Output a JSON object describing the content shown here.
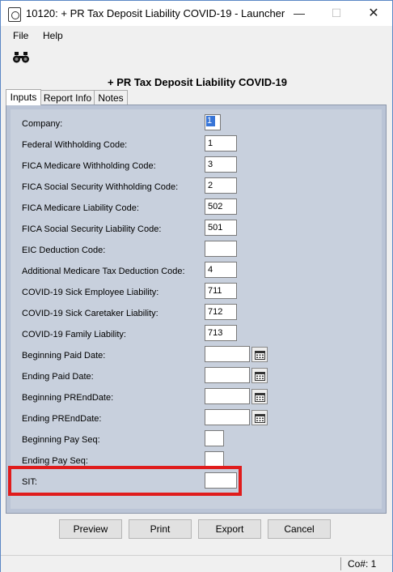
{
  "window": {
    "title": "10120: + PR Tax Deposit Liability COVID-19 - Launcher",
    "minimize_glyph": "—",
    "maximize_glyph": "☐",
    "close_glyph": "✕"
  },
  "menu": {
    "items": [
      "File",
      "Help"
    ]
  },
  "toolbar": {
    "icon": "binoculars-icon"
  },
  "heading": "+ PR Tax Deposit Liability COVID-19",
  "tabs": [
    "Inputs",
    "Report Info",
    "Notes"
  ],
  "form": {
    "fields": [
      {
        "label": "Company:",
        "value": "1"
      },
      {
        "label": "Federal Withholding Code:",
        "value": "1"
      },
      {
        "label": "FICA Medicare Withholding Code:",
        "value": "3"
      },
      {
        "label": "FICA Social Security Withholding Code:",
        "value": "2"
      },
      {
        "label": "FICA Medicare Liability Code:",
        "value": "502"
      },
      {
        "label": "FICA Social Security Liability Code:",
        "value": "501"
      },
      {
        "label": "EIC Deduction Code:",
        "value": ""
      },
      {
        "label": "Additional Medicare Tax Deduction Code:",
        "value": "4"
      },
      {
        "label": "COVID-19 Sick Employee Liability:",
        "value": "711"
      },
      {
        "label": "COVID-19 Sick Caretaker Liability:",
        "value": "712"
      },
      {
        "label": "COVID-19 Family Liability:",
        "value": "713"
      },
      {
        "label": "Beginning Paid Date:",
        "value": ""
      },
      {
        "label": "Ending Paid Date:",
        "value": ""
      },
      {
        "label": "Beginning PREndDate:",
        "value": ""
      },
      {
        "label": "Ending PREndDate:",
        "value": ""
      },
      {
        "label": "Beginning Pay Seq:",
        "value": ""
      },
      {
        "label": "Ending Pay Seq:",
        "value": ""
      },
      {
        "label": "SIT:",
        "value": ""
      }
    ]
  },
  "buttons": {
    "preview": "Preview",
    "print": "Print",
    "export": "Export",
    "cancel": "Cancel"
  },
  "status": {
    "company": "Co#: 1"
  },
  "colors": {
    "panel": "#c8d0dd",
    "highlight": "#e01c1c",
    "selection": "#3875d7"
  }
}
